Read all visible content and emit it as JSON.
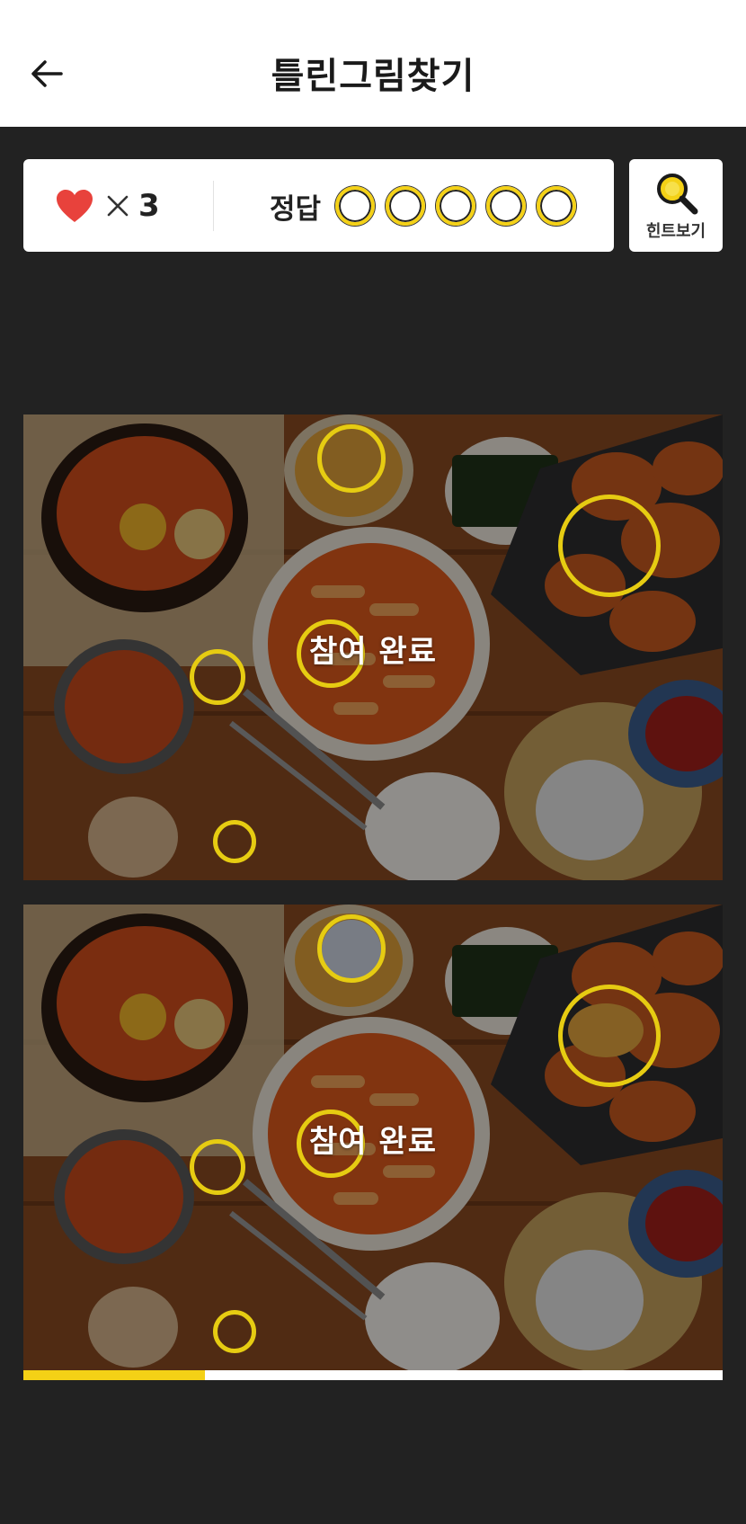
{
  "header": {
    "title": "틀린그림찾기",
    "back_icon": "arrow-left-icon"
  },
  "status": {
    "lives_icon": "heart-icon",
    "lives_count": "3",
    "answers_label": "정답",
    "answer_slots": 5,
    "answers_found": 0,
    "heart_color": "#e8423c",
    "slot_color": "#f4d116"
  },
  "hint": {
    "label": "힌트보기",
    "icon": "magnifier-icon"
  },
  "puzzle": {
    "top_overlay_text": "참여 완료",
    "bottom_overlay_text": "참여 완료",
    "differences_marked": 5
  },
  "progress": {
    "fraction": 0.26,
    "color": "#f4d116"
  }
}
